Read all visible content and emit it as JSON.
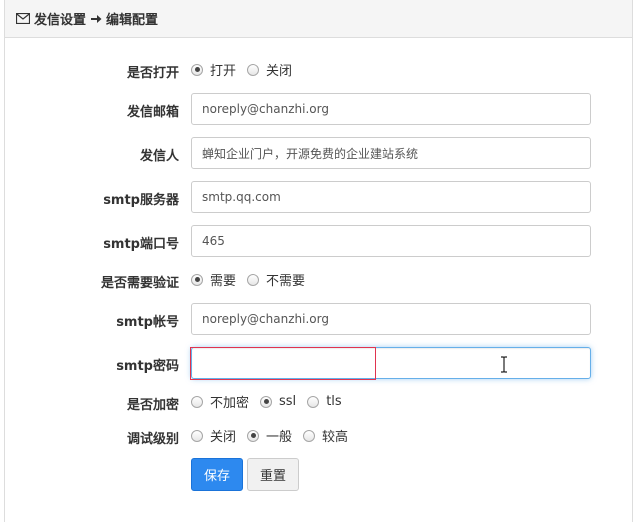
{
  "header": {
    "title": "发信设置",
    "subtitle": "编辑配置",
    "icon": "envelope-icon",
    "sep_icon": "arrow-right-icon"
  },
  "form": {
    "enabled": {
      "label": "是否打开",
      "options": [
        "打开",
        "关闭"
      ],
      "selected": 0
    },
    "sender_email": {
      "label": "发信邮箱",
      "value": "noreply@chanzhi.org"
    },
    "sender_name": {
      "label": "发信人",
      "value": "蝉知企业门户，开源免费的企业建站系统"
    },
    "smtp_host": {
      "label": "smtp服务器",
      "value": "smtp.qq.com"
    },
    "smtp_port": {
      "label": "smtp端口号",
      "value": "465"
    },
    "auth": {
      "label": "是否需要验证",
      "options": [
        "需要",
        "不需要"
      ],
      "selected": 0
    },
    "smtp_user": {
      "label": "smtp帐号",
      "value": "noreply@chanzhi.org"
    },
    "smtp_pass": {
      "label": "smtp密码",
      "value": ""
    },
    "secure": {
      "label": "是否加密",
      "options": [
        "不加密",
        "ssl",
        "tls"
      ],
      "selected": 1
    },
    "debug": {
      "label": "调试级别",
      "options": [
        "关闭",
        "一般",
        "较高"
      ],
      "selected": 1
    }
  },
  "buttons": {
    "save": "保存",
    "reset": "重置"
  },
  "colors": {
    "primary": "#2d89ef",
    "focus": "#66afe9",
    "highlight": "#e0334f"
  }
}
